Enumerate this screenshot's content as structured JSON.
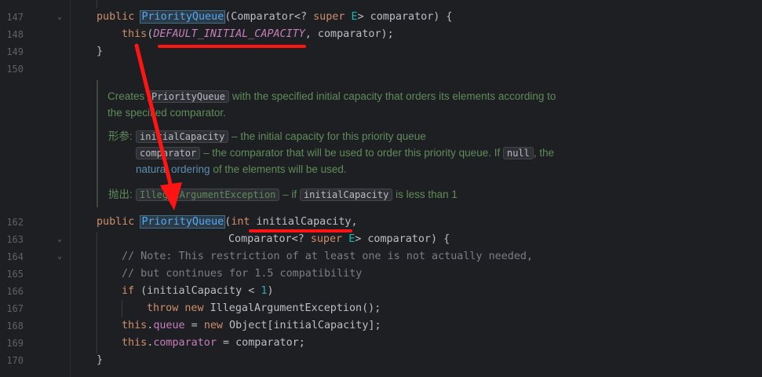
{
  "gutter": {
    "line_numbers": [
      "147",
      "148",
      "149",
      "150",
      "162",
      "163",
      "164",
      "165",
      "166",
      "167",
      "168",
      "169",
      "170"
    ]
  },
  "code": {
    "l147": {
      "kw": "public",
      "cls": "PriorityQueue",
      "open": "(Comparator<? ",
      "super": "super",
      "e": "E",
      "rest": "> comparator) {"
    },
    "l148": {
      "this": "this",
      "open": "(",
      "const": "DEFAULT_INITIAL_CAPACITY",
      "rest": ", comparator);"
    },
    "l149": {
      "text": "}"
    },
    "l162": {
      "kw": "public",
      "cls": "PriorityQueue",
      "open": "(",
      "int": "int",
      "rest": " initialCapacity,"
    },
    "l163": {
      "pre": "Comparator<? ",
      "super": "super",
      "e": "E",
      "rest": "> comparator) {"
    },
    "l164": {
      "text": "// Note: This restriction of at least one is not actually needed,"
    },
    "l165": {
      "text": "// but continues for 1.5 compatibility"
    },
    "l166": {
      "if": "if",
      "mid": " (initialCapacity < ",
      "num": "1",
      "end": ")"
    },
    "l167": {
      "throw": "throw",
      "sp": " ",
      "new": "new",
      "rest": " IllegalArgumentException();"
    },
    "l168": {
      "this": "this",
      "dot": ".",
      "field": "queue",
      "mid": " = ",
      "new": "new",
      "rest": " Object[initialCapacity];"
    },
    "l169": {
      "this": "this",
      "dot": ".",
      "field": "comparator",
      "rest": " = comparator;"
    },
    "l170": {
      "text": "}"
    }
  },
  "doc": {
    "line1_pre": "Creates",
    "line1_chip": "PriorityQueue",
    "line1_post": "with the specified initial capacity that orders its elements according to",
    "line2": "the specified comparator.",
    "params_label": "形参:",
    "p1_chip": "initialCapacity",
    "p1_text": "– the initial capacity for this priority queue",
    "p2_chip": "comparator",
    "p2_text": "– the comparator that will be used to order this priority queue. If",
    "p2_null": "null",
    "p2_end": ", the",
    "p2_link": "natural ordering",
    "p2_tail": "of the elements will be used.",
    "throws_label": "抛出:",
    "t_chip": "IllegalArgumentException",
    "t_text": "– if",
    "t_chip2": "initialCapacity",
    "t_tail": "is less than 1"
  },
  "colors": {
    "background": "#1e1f22",
    "keyword": "#cf8e6d",
    "function": "#56a8f5",
    "constant": "#c77dbb",
    "comment": "#7a7e85",
    "doc_text": "#5f8c5a",
    "annotation": "#ff1414"
  }
}
